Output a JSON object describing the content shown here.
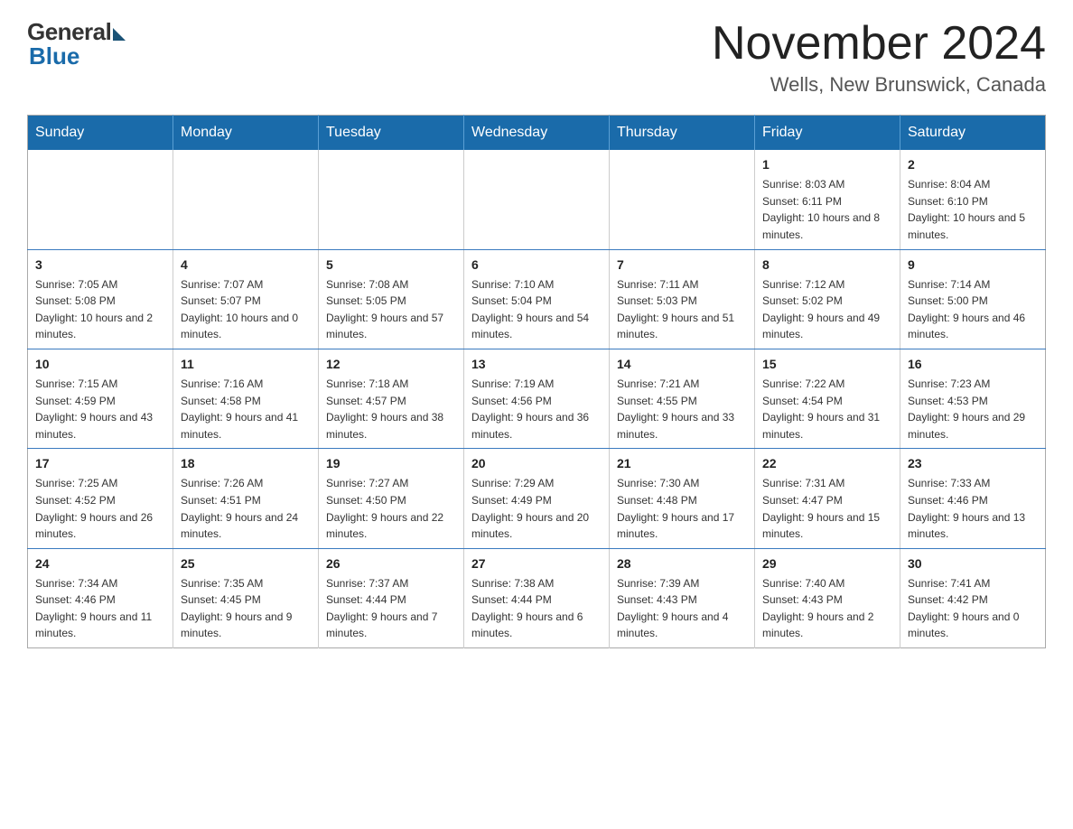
{
  "header": {
    "logo_general": "General",
    "logo_blue": "Blue",
    "month_title": "November 2024",
    "location": "Wells, New Brunswick, Canada"
  },
  "weekdays": [
    "Sunday",
    "Monday",
    "Tuesday",
    "Wednesday",
    "Thursday",
    "Friday",
    "Saturday"
  ],
  "weeks": [
    [
      {
        "day": "",
        "info": ""
      },
      {
        "day": "",
        "info": ""
      },
      {
        "day": "",
        "info": ""
      },
      {
        "day": "",
        "info": ""
      },
      {
        "day": "",
        "info": ""
      },
      {
        "day": "1",
        "info": "Sunrise: 8:03 AM\nSunset: 6:11 PM\nDaylight: 10 hours and 8 minutes."
      },
      {
        "day": "2",
        "info": "Sunrise: 8:04 AM\nSunset: 6:10 PM\nDaylight: 10 hours and 5 minutes."
      }
    ],
    [
      {
        "day": "3",
        "info": "Sunrise: 7:05 AM\nSunset: 5:08 PM\nDaylight: 10 hours and 2 minutes."
      },
      {
        "day": "4",
        "info": "Sunrise: 7:07 AM\nSunset: 5:07 PM\nDaylight: 10 hours and 0 minutes."
      },
      {
        "day": "5",
        "info": "Sunrise: 7:08 AM\nSunset: 5:05 PM\nDaylight: 9 hours and 57 minutes."
      },
      {
        "day": "6",
        "info": "Sunrise: 7:10 AM\nSunset: 5:04 PM\nDaylight: 9 hours and 54 minutes."
      },
      {
        "day": "7",
        "info": "Sunrise: 7:11 AM\nSunset: 5:03 PM\nDaylight: 9 hours and 51 minutes."
      },
      {
        "day": "8",
        "info": "Sunrise: 7:12 AM\nSunset: 5:02 PM\nDaylight: 9 hours and 49 minutes."
      },
      {
        "day": "9",
        "info": "Sunrise: 7:14 AM\nSunset: 5:00 PM\nDaylight: 9 hours and 46 minutes."
      }
    ],
    [
      {
        "day": "10",
        "info": "Sunrise: 7:15 AM\nSunset: 4:59 PM\nDaylight: 9 hours and 43 minutes."
      },
      {
        "day": "11",
        "info": "Sunrise: 7:16 AM\nSunset: 4:58 PM\nDaylight: 9 hours and 41 minutes."
      },
      {
        "day": "12",
        "info": "Sunrise: 7:18 AM\nSunset: 4:57 PM\nDaylight: 9 hours and 38 minutes."
      },
      {
        "day": "13",
        "info": "Sunrise: 7:19 AM\nSunset: 4:56 PM\nDaylight: 9 hours and 36 minutes."
      },
      {
        "day": "14",
        "info": "Sunrise: 7:21 AM\nSunset: 4:55 PM\nDaylight: 9 hours and 33 minutes."
      },
      {
        "day": "15",
        "info": "Sunrise: 7:22 AM\nSunset: 4:54 PM\nDaylight: 9 hours and 31 minutes."
      },
      {
        "day": "16",
        "info": "Sunrise: 7:23 AM\nSunset: 4:53 PM\nDaylight: 9 hours and 29 minutes."
      }
    ],
    [
      {
        "day": "17",
        "info": "Sunrise: 7:25 AM\nSunset: 4:52 PM\nDaylight: 9 hours and 26 minutes."
      },
      {
        "day": "18",
        "info": "Sunrise: 7:26 AM\nSunset: 4:51 PM\nDaylight: 9 hours and 24 minutes."
      },
      {
        "day": "19",
        "info": "Sunrise: 7:27 AM\nSunset: 4:50 PM\nDaylight: 9 hours and 22 minutes."
      },
      {
        "day": "20",
        "info": "Sunrise: 7:29 AM\nSunset: 4:49 PM\nDaylight: 9 hours and 20 minutes."
      },
      {
        "day": "21",
        "info": "Sunrise: 7:30 AM\nSunset: 4:48 PM\nDaylight: 9 hours and 17 minutes."
      },
      {
        "day": "22",
        "info": "Sunrise: 7:31 AM\nSunset: 4:47 PM\nDaylight: 9 hours and 15 minutes."
      },
      {
        "day": "23",
        "info": "Sunrise: 7:33 AM\nSunset: 4:46 PM\nDaylight: 9 hours and 13 minutes."
      }
    ],
    [
      {
        "day": "24",
        "info": "Sunrise: 7:34 AM\nSunset: 4:46 PM\nDaylight: 9 hours and 11 minutes."
      },
      {
        "day": "25",
        "info": "Sunrise: 7:35 AM\nSunset: 4:45 PM\nDaylight: 9 hours and 9 minutes."
      },
      {
        "day": "26",
        "info": "Sunrise: 7:37 AM\nSunset: 4:44 PM\nDaylight: 9 hours and 7 minutes."
      },
      {
        "day": "27",
        "info": "Sunrise: 7:38 AM\nSunset: 4:44 PM\nDaylight: 9 hours and 6 minutes."
      },
      {
        "day": "28",
        "info": "Sunrise: 7:39 AM\nSunset: 4:43 PM\nDaylight: 9 hours and 4 minutes."
      },
      {
        "day": "29",
        "info": "Sunrise: 7:40 AM\nSunset: 4:43 PM\nDaylight: 9 hours and 2 minutes."
      },
      {
        "day": "30",
        "info": "Sunrise: 7:41 AM\nSunset: 4:42 PM\nDaylight: 9 hours and 0 minutes."
      }
    ]
  ]
}
